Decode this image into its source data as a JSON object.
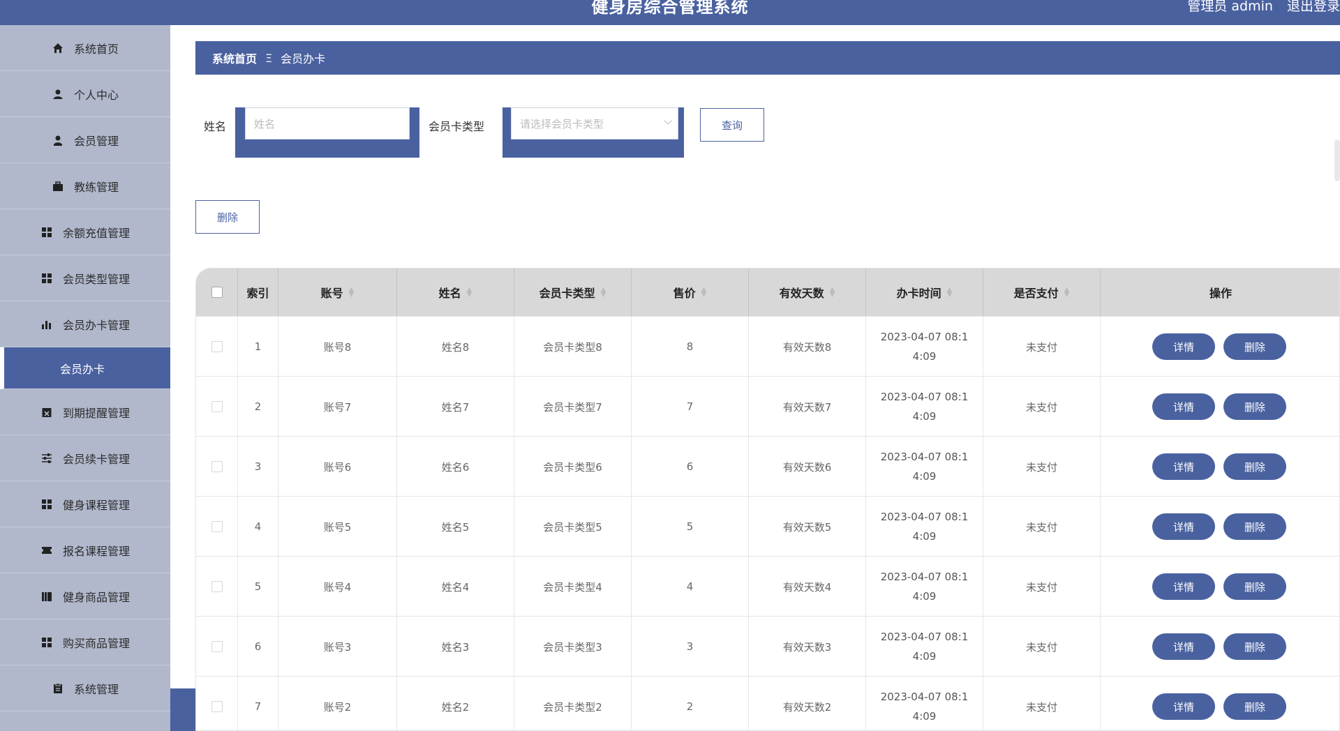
{
  "header": {
    "title": "健身房综合管理系统",
    "user_label": "管理员 admin",
    "logout_label": "退出登录"
  },
  "sidebar": {
    "items": [
      {
        "label": "系统首页",
        "icon": "home-icon"
      },
      {
        "label": "个人中心",
        "icon": "user-icon"
      },
      {
        "label": "会员管理",
        "icon": "user-tie-icon"
      },
      {
        "label": "教练管理",
        "icon": "briefcase-icon"
      },
      {
        "label": "余额充值管理",
        "icon": "grid-icon"
      },
      {
        "label": "会员类型管理",
        "icon": "grid-icon"
      },
      {
        "label": "会员办卡管理",
        "icon": "bar-chart-icon"
      },
      {
        "label": "会员办卡",
        "icon": ""
      },
      {
        "label": "到期提醒管理",
        "icon": "calendar-x-icon"
      },
      {
        "label": "会员续卡管理",
        "icon": "sliders-icon"
      },
      {
        "label": "健身课程管理",
        "icon": "grid-icon"
      },
      {
        "label": "报名课程管理",
        "icon": "ticket-icon"
      },
      {
        "label": "健身商品管理",
        "icon": "book-icon"
      },
      {
        "label": "购买商品管理",
        "icon": "grid-icon"
      },
      {
        "label": "系统管理",
        "icon": "clipboard-icon"
      }
    ]
  },
  "breadcrumb": {
    "home": "系统首页",
    "separator": "Ξ",
    "current": "会员办卡"
  },
  "search": {
    "name_label": "姓名",
    "name_placeholder": "姓名",
    "card_type_label": "会员卡类型",
    "card_type_placeholder": "请选择会员卡类型",
    "query_label": "查询"
  },
  "toolbar": {
    "delete_label": "删除"
  },
  "table": {
    "columns": [
      "索引",
      "账号",
      "姓名",
      "会员卡类型",
      "售价",
      "有效天数",
      "办卡时间",
      "是否支付",
      "操作"
    ],
    "detail_label": "详情",
    "delete_label": "删除",
    "rows": [
      {
        "index": "1",
        "account": "账号8",
        "name": "姓名8",
        "card_type": "会员卡类型8",
        "price": "8",
        "days": "有效天数8",
        "time": "2023-04-07 08:14:09",
        "paid": "未支付"
      },
      {
        "index": "2",
        "account": "账号7",
        "name": "姓名7",
        "card_type": "会员卡类型7",
        "price": "7",
        "days": "有效天数7",
        "time": "2023-04-07 08:14:09",
        "paid": "未支付"
      },
      {
        "index": "3",
        "account": "账号6",
        "name": "姓名6",
        "card_type": "会员卡类型6",
        "price": "6",
        "days": "有效天数6",
        "time": "2023-04-07 08:14:09",
        "paid": "未支付"
      },
      {
        "index": "4",
        "account": "账号5",
        "name": "姓名5",
        "card_type": "会员卡类型5",
        "price": "5",
        "days": "有效天数5",
        "time": "2023-04-07 08:14:09",
        "paid": "未支付"
      },
      {
        "index": "5",
        "account": "账号4",
        "name": "姓名4",
        "card_type": "会员卡类型4",
        "price": "4",
        "days": "有效天数4",
        "time": "2023-04-07 08:14:09",
        "paid": "未支付"
      },
      {
        "index": "6",
        "account": "账号3",
        "name": "姓名3",
        "card_type": "会员卡类型3",
        "price": "3",
        "days": "有效天数3",
        "time": "2023-04-07 08:14:09",
        "paid": "未支付"
      },
      {
        "index": "7",
        "account": "账号2",
        "name": "姓名2",
        "card_type": "会员卡类型2",
        "price": "2",
        "days": "有效天数2",
        "time": "2023-04-07 08:14:09",
        "paid": "未支付"
      }
    ]
  },
  "colors": {
    "primary": "#4a61a0",
    "sidebar_bg": "#b1b8cc",
    "table_header_bg": "#d8d8d8"
  }
}
